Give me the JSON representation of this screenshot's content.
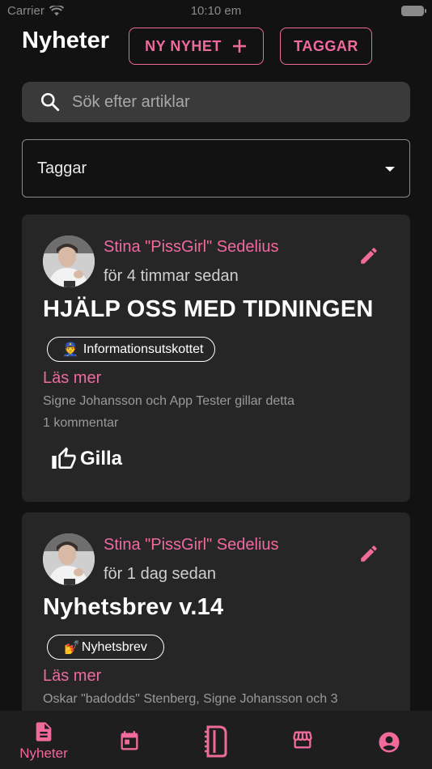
{
  "status_bar": {
    "carrier": "Carrier",
    "time": "10:10 em"
  },
  "header": {
    "title": "Nyheter",
    "new_button": "NY NYHET",
    "tags_button": "TAGGAR"
  },
  "search": {
    "placeholder": "Sök efter artiklar"
  },
  "tag_filter": {
    "label": "Taggar"
  },
  "posts": [
    {
      "author": "Stina \"PissGirl\" Sedelius",
      "time": "för 4 timmar sedan",
      "title": "HJÄLP OSS MED TIDNINGEN",
      "tag_emoji": "👮",
      "tag": "Informationsutskottet",
      "read_more": "Läs mer",
      "likes": "Signe Johansson och App Tester gillar detta",
      "comments": "1 kommentar",
      "like_label": "Gilla"
    },
    {
      "author": "Stina \"PissGirl\" Sedelius",
      "time": "för 1 dag sedan",
      "title": "Nyhetsbrev v.14",
      "tag_emoji": "💅",
      "tag": "Nyhetsbrev",
      "read_more": "Läs mer",
      "likes": "Oskar \"badodds\" Stenberg, Signe Johansson och 3"
    }
  ],
  "bottom_nav": {
    "active_label": "Nyheter",
    "items": [
      "news-icon",
      "calendar-icon",
      "comb-icon",
      "store-icon",
      "account-icon"
    ]
  },
  "colors": {
    "accent": "#f06a9a",
    "background": "#121212",
    "card": "#262626",
    "search_bg": "#3a3a3a"
  }
}
